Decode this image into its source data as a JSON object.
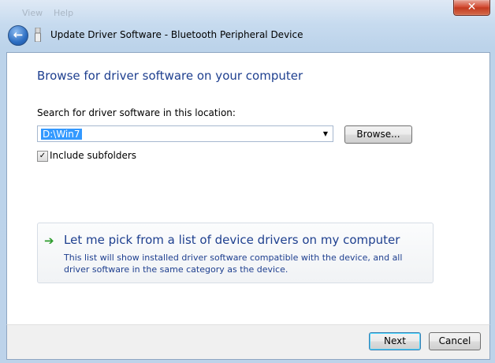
{
  "background_menu": {
    "view": "View",
    "help": "Help"
  },
  "window": {
    "title": "Update Driver Software - Bluetooth Peripheral Device",
    "close_glyph": "✕",
    "back_glyph": "←"
  },
  "page": {
    "heading": "Browse for driver software on your computer",
    "search_label": "Search for driver software in this location:",
    "location_value": "D:\\Win7",
    "browse_label": "Browse...",
    "include_subfolders_label": "Include subfolders",
    "include_subfolders_checked": true
  },
  "pick": {
    "title": "Let me pick from a list of device drivers on my computer",
    "description": "This list will show installed driver software compatible with the device, and all driver software in the same category as the device."
  },
  "footer": {
    "next_label": "Next",
    "cancel_label": "Cancel"
  },
  "colors": {
    "heading_blue": "#1e3f8f",
    "link_arrow_green": "#2d9c2d",
    "selection_blue": "#3399ff"
  }
}
